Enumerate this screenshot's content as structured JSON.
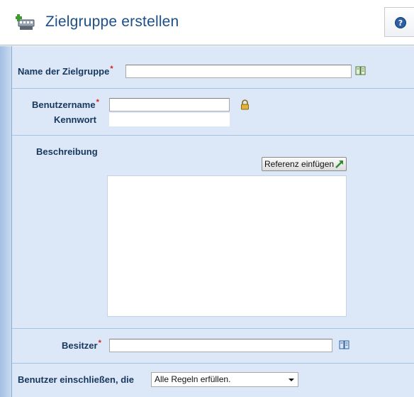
{
  "header": {
    "title": "Zielgruppe erstellen",
    "help_label": "?"
  },
  "form": {
    "name_label": "Name der Zielgruppe",
    "name_value": "",
    "username_label": "Benutzername",
    "username_value": "",
    "password_label": "Kennwort",
    "password_value": "",
    "description_label": "Beschreibung",
    "insert_reference_label": "Referenz einfügen",
    "description_value": "",
    "owner_label": "Besitzer",
    "owner_value": "",
    "include_users_label": "Benutzer einschließen, die",
    "include_users_selected": "Alle Regeln erfüllen.",
    "required_marker": "*"
  },
  "colors": {
    "title": "#1b4f8a",
    "label": "#17375e",
    "panel_bg": "#dce8f7",
    "required": "#d22020"
  }
}
